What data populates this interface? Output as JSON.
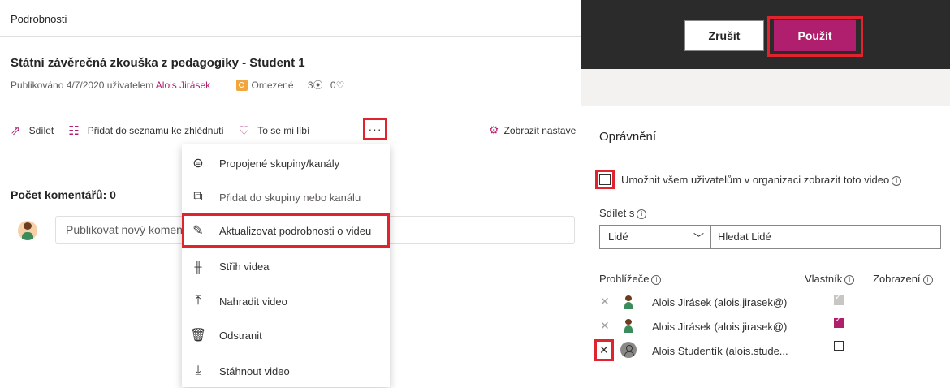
{
  "details": {
    "tab_label": "Podrobnosti",
    "video_title": "Státní závěrečná zkouška z pedagogiky - Student 1",
    "published_prefix": "Publikováno 4/7/2020 uživatelem",
    "publisher": "Alois Jirásek",
    "privacy": "Omezené",
    "views": "3",
    "likes": "0",
    "view_icon": "play-circle-icon",
    "like_icon": "heart-icon"
  },
  "toolbar": {
    "share": "Sdílet",
    "add_watchlist": "Přidat do seznamu ke zhlédnutí",
    "like": "To se mi líbí",
    "more": "···",
    "settings": "Zobrazit nastave"
  },
  "comments": {
    "count_label": "Počet komentářů: 0",
    "input_placeholder": "Publikovat nový komentář"
  },
  "menu": {
    "items": [
      {
        "label": "Propojené skupiny/kanály",
        "icon": "globe-icon"
      },
      {
        "label": "Přidat do skupiny nebo kanálu",
        "icon": "add-to-group-icon"
      },
      {
        "label": "Aktualizovat podrobnosti o videu",
        "icon": "pencil-icon"
      },
      {
        "label": "Střih videa",
        "icon": "trim-icon"
      },
      {
        "label": "Nahradit video",
        "icon": "upload-icon"
      },
      {
        "label": "Odstranit",
        "icon": "trash-icon"
      },
      {
        "label": "Stáhnout video",
        "icon": "download-icon"
      }
    ]
  },
  "dialog": {
    "cancel": "Zrušit",
    "apply": "Použít",
    "permissions_title": "Oprávnění",
    "allow_org": "Umožnit všem uživatelům v organizaci zobrazit toto video",
    "share_with": "Sdílet s",
    "share_type": "Lidé",
    "search_placeholder": "Hledat Lidé",
    "viewers_label": "Prohlížeče",
    "owner_label": "Vlastník",
    "view_label": "Zobrazení",
    "info_glyph": "i",
    "viewers": [
      {
        "name": "Alois Jirásek (alois.jirasek@)",
        "owner_checked": true,
        "owner_locked": true
      },
      {
        "name": "Alois Jirásek (alois.jirasek@)",
        "owner_checked": true,
        "owner_locked": false
      },
      {
        "name": "Alois Studentík (alois.stude...",
        "owner_checked": false,
        "owner_locked": false
      }
    ]
  },
  "colors": {
    "accent": "#b01e6e",
    "highlight": "#e0242f",
    "dark_bar": "#2b2b2b"
  }
}
